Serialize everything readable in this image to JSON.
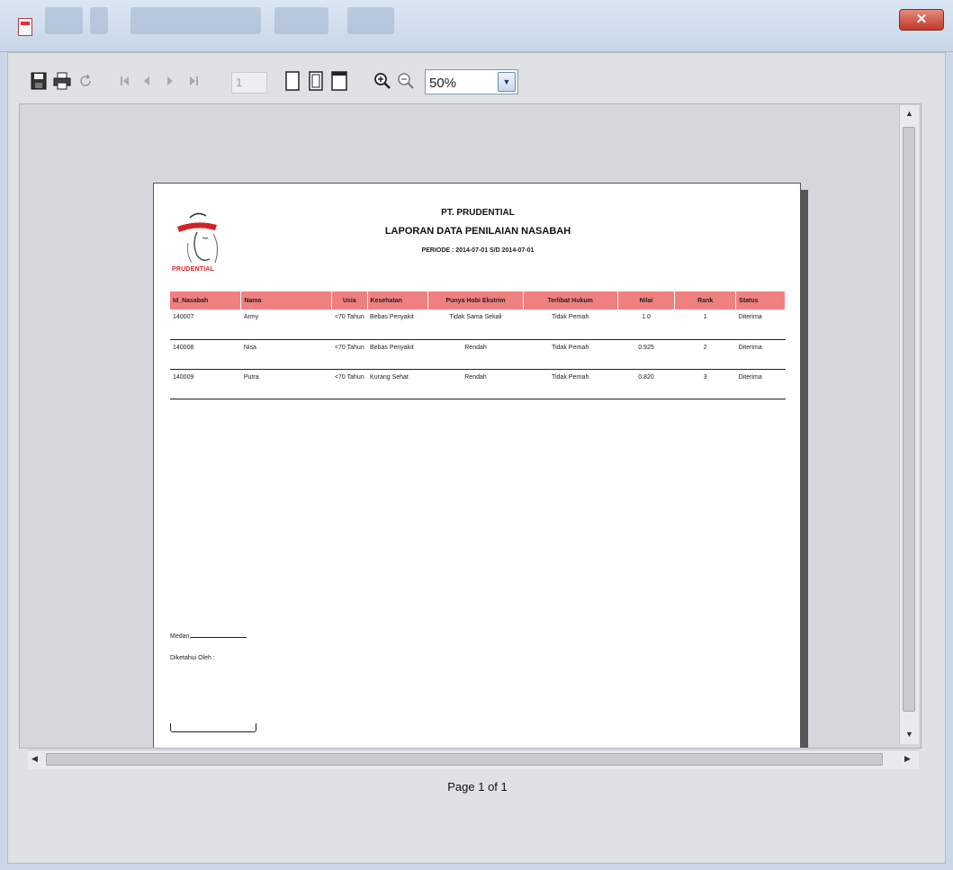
{
  "toolbar": {
    "page_number": "1",
    "zoom_value": "50%"
  },
  "report": {
    "company": "PT. PRUDENTIAL",
    "title": "LAPORAN DATA PENILAIAN NASABAH",
    "period": "PERIODE : 2014-07-01  S/D 2014-07-01",
    "logo_text": "PRUDENTIAL",
    "columns": [
      "Id_Nasabah",
      "Nama",
      "Usia",
      "Kesehatan",
      "Punya Hobi Ekstrim",
      "Terlibat Hukum",
      "Nilai",
      "Rank",
      "Status"
    ],
    "rows": [
      [
        "140007",
        "Army",
        "<70 Tahun",
        "Bebas Penyakit",
        "Tidak Sama Sekali",
        "Tidak Pernah",
        "1.0",
        "1",
        "Diterima"
      ],
      [
        "140008",
        "Nisa",
        "<70 Tahun",
        "Bebas Penyakit",
        "Rendah",
        "Tidak Pernah",
        "0.925",
        "2",
        "Diterima"
      ],
      [
        "140009",
        "Putra",
        "<70 Tahun",
        "Kurang Sehat",
        "Rendah",
        "Tidak Pernah",
        "0.820",
        "3",
        "Diterima"
      ]
    ],
    "sign_place": "Medan,",
    "sign_known": "Diketahui Oleh :"
  },
  "footer": {
    "page_label": "Page 1 of 1"
  },
  "colors": {
    "header_fill": "#f08080",
    "logo_red": "#d22222"
  },
  "icons": [
    "save-icon",
    "print-icon",
    "reload-icon",
    "first-page-icon",
    "previous-page-icon",
    "next-page-icon",
    "last-page-icon",
    "actual-size-icon",
    "fit-page-icon",
    "fit-width-icon",
    "zoom-in-icon",
    "zoom-out-icon",
    "close-icon"
  ]
}
